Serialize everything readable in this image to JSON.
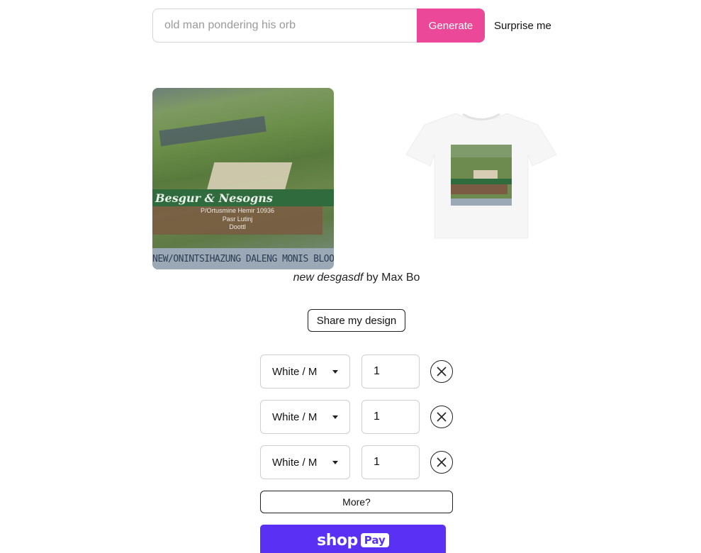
{
  "search": {
    "placeholder": "old man pondering his orb",
    "generate_label": "Generate",
    "surprise_label": "Surprise me"
  },
  "design_image": {
    "banner_text": "Besgur & Nesogns",
    "sub_line_1": "P/Ortusmine Hemir 10936",
    "sub_line_2": "Pasr Lutinj",
    "sub_line_3": "Doottl",
    "bottom_text": "NEW/ONINTSIHAZUNG DALENG MONIS BLOOF"
  },
  "caption": {
    "title": "new desgasdf",
    "by": "by",
    "author": "Max Bo"
  },
  "share_label": "Share my design",
  "line_items": [
    {
      "variant": "White / M",
      "quantity": "1"
    },
    {
      "variant": "White / M",
      "quantity": "1"
    },
    {
      "variant": "White / M",
      "quantity": "1"
    }
  ],
  "more_label": "More?",
  "shop_pay": {
    "shop": "shop",
    "pay": "Pay"
  },
  "colors": {
    "accent": "#ec4899",
    "shop_pay": "#5a31f4"
  }
}
